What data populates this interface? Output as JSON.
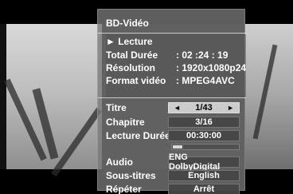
{
  "osd": {
    "title": "BD-Vidéo",
    "info": {
      "playback": "► Lecture",
      "total_duration_label": "Total Durée",
      "total_duration_value": ": 02 :24 : 19",
      "resolution_label": "Résolution",
      "resolution_value": ": 1920x1080p24",
      "video_format_label": "Format vidéo",
      "video_format_value": ": MPEG4AVC"
    },
    "controls": {
      "title_label": "Titre",
      "title_value": "1/43",
      "chapter_label": "Chapitre",
      "chapter_value": "3/16",
      "playback_duration_label": "Lecture Durée",
      "playback_duration_value": "00:30:00",
      "audio_label": "Audio",
      "audio_value": "ENG DolbyDigital",
      "subtitles_label": "Sous-titres",
      "subtitles_value": "English",
      "repeat_label": "Répéter",
      "repeat_value": "Arrêt"
    },
    "icons": {
      "left": "chevron-left-icon",
      "right": "chevron-right-icon"
    },
    "progress_fraction": 0.14
  }
}
